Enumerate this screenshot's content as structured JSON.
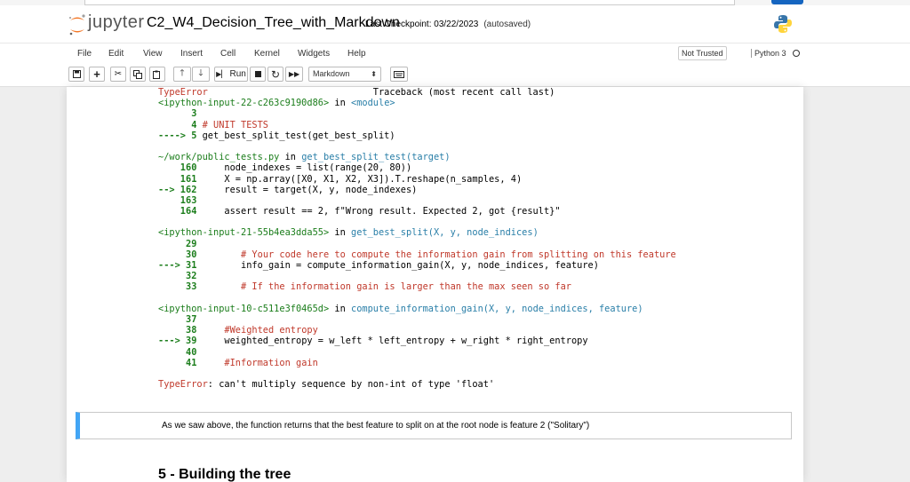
{
  "app": {
    "logo_text": "jupyter",
    "notebook_title": "C2_W4_Decision_Tree_with_Markdown",
    "checkpoint": "Last Checkpoint: 03/22/2023",
    "autosaved": "(autosaved)"
  },
  "menu": [
    "File",
    "Edit",
    "View",
    "Insert",
    "Cell",
    "Kernel",
    "Widgets",
    "Help"
  ],
  "status": {
    "trusted": "Not Trusted",
    "kernel": "Python 3"
  },
  "toolbar": {
    "run_label": "Run",
    "cell_type": "Markdown"
  },
  "traceback": [
    [
      [
        "TypeError",
        "red"
      ],
      [
        "                              Traceback (most recent call last)",
        ""
      ]
    ],
    [
      [
        "<ipython-input-22-c263c9190d86>",
        "green2"
      ],
      [
        " in ",
        ""
      ],
      [
        "<module>",
        "cyan"
      ]
    ],
    [
      [
        "      3",
        "green"
      ]
    ],
    [
      [
        "      4 ",
        "green"
      ],
      [
        "# UNIT TESTS",
        "red"
      ]
    ],
    [
      [
        "----> 5 ",
        "green"
      ],
      [
        "get_best_split_test(get_best_split)",
        ""
      ]
    ],
    [
      [
        "",
        ""
      ]
    ],
    [
      [
        "~/work/public_tests.py",
        "green2"
      ],
      [
        " in ",
        ""
      ],
      [
        "get_best_split_test(target)",
        "cyan"
      ]
    ],
    [
      [
        "    160",
        "green"
      ],
      [
        "     node_indexes = list(range(20, 80))",
        ""
      ]
    ],
    [
      [
        "    161",
        "green"
      ],
      [
        "     X = np.array([X0, X1, X2, X3]).T.reshape(n_samples, 4)",
        ""
      ]
    ],
    [
      [
        "--> 162",
        "green"
      ],
      [
        "     result = target(X, y, node_indexes)",
        ""
      ]
    ],
    [
      [
        "    163",
        "green"
      ]
    ],
    [
      [
        "    164",
        "green"
      ],
      [
        "     assert result == 2, f\"Wrong result. Expected 2, got {result}\"",
        ""
      ]
    ],
    [
      [
        "",
        ""
      ]
    ],
    [
      [
        "<ipython-input-21-55b4ea3dda55>",
        "green2"
      ],
      [
        " in ",
        ""
      ],
      [
        "get_best_split(X, y, node_indices)",
        "cyan"
      ]
    ],
    [
      [
        "     29",
        "green"
      ]
    ],
    [
      [
        "     30",
        "green"
      ],
      [
        "        ",
        ""
      ],
      [
        "# Your code here to compute the information gain from splitting on this feature",
        "red"
      ]
    ],
    [
      [
        "---> 31",
        "green"
      ],
      [
        "        info_gain = compute_information_gain(X, y, node_indices, feature)",
        ""
      ]
    ],
    [
      [
        "     32",
        "green"
      ]
    ],
    [
      [
        "     33",
        "green"
      ],
      [
        "        ",
        ""
      ],
      [
        "# If the information gain is larger than the max seen so far",
        "red"
      ]
    ],
    [
      [
        "",
        ""
      ]
    ],
    [
      [
        "<ipython-input-10-c511e3f0465d>",
        "green2"
      ],
      [
        " in ",
        ""
      ],
      [
        "compute_information_gain(X, y, node_indices, feature)",
        "cyan"
      ]
    ],
    [
      [
        "     37",
        "green"
      ]
    ],
    [
      [
        "     38",
        "green"
      ],
      [
        "     ",
        ""
      ],
      [
        "#Weighted entropy",
        "red"
      ]
    ],
    [
      [
        "---> 39",
        "green"
      ],
      [
        "     weighted_entropy = w_left * left_entropy + w_right * right_entropy",
        ""
      ]
    ],
    [
      [
        "     40",
        "green"
      ]
    ],
    [
      [
        "     41",
        "green"
      ],
      [
        "     ",
        ""
      ],
      [
        "#Information gain",
        "red"
      ]
    ],
    [
      [
        "",
        ""
      ]
    ],
    [
      [
        "TypeError",
        "red"
      ],
      [
        ": can't multiply sequence by non-int of type 'float'",
        ""
      ]
    ]
  ],
  "markdown_cell": {
    "text": "As we saw above, the function returns that the best feature to split on at the root node is feature 2 (\"Solitary\")"
  },
  "section_heading": "5 - Building the tree",
  "colors": {
    "accent": "#42a5f5",
    "error_red": "#c0392b",
    "line_green": "#1b7d1b",
    "code_cyan": "#2a7fa8"
  }
}
